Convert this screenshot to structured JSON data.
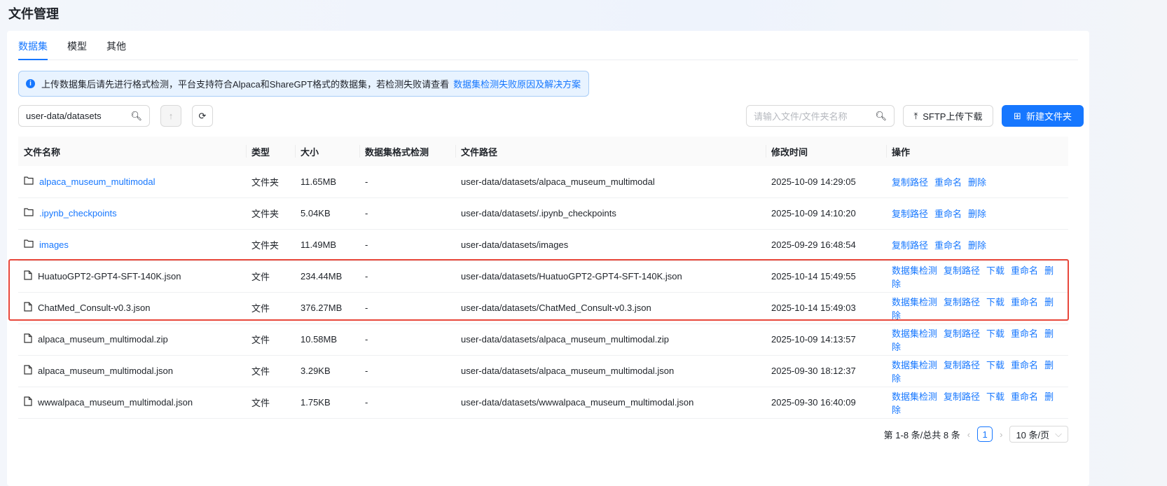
{
  "title": "文件管理",
  "tabs": [
    {
      "label": "数据集",
      "active": true
    },
    {
      "label": "模型"
    },
    {
      "label": "其他"
    }
  ],
  "notice": {
    "text": "上传数据集后请先进行格式检测，平台支持符合Alpaca和ShareGPT格式的数据集，若检测失败请查看",
    "link": "数据集检测失败原因及解决方案"
  },
  "path_input": {
    "value": "user-data/datasets"
  },
  "search": {
    "placeholder": "请输入文件/文件夹名称"
  },
  "buttons": {
    "sftp": "SFTP上传下载",
    "new_folder": "新建文件夹"
  },
  "columns": [
    "文件名称",
    "类型",
    "大小",
    "数据集格式检测",
    "文件路径",
    "修改时间",
    "操作"
  ],
  "rows": [
    {
      "name": "alpaca_museum_multimodal",
      "type": "文件夹",
      "size": "11.65MB",
      "check": "-",
      "path": "user-data/datasets/alpaca_museum_multimodal",
      "time": "2025-10-09 14:29:05",
      "folder": true,
      "ops": [
        "复制路径",
        "重命名",
        "删除"
      ]
    },
    {
      "name": ".ipynb_checkpoints",
      "type": "文件夹",
      "size": "5.04KB",
      "check": "-",
      "path": "user-data/datasets/.ipynb_checkpoints",
      "time": "2025-10-09 14:10:20",
      "folder": true,
      "ops": [
        "复制路径",
        "重命名",
        "删除"
      ]
    },
    {
      "name": "images",
      "type": "文件夹",
      "size": "11.49MB",
      "check": "-",
      "path": "user-data/datasets/images",
      "time": "2025-09-29 16:48:54",
      "folder": true,
      "ops": [
        "复制路径",
        "重命名",
        "删除"
      ]
    },
    {
      "name": "HuatuoGPT2-GPT4-SFT-140K.json",
      "type": "文件",
      "size": "234.44MB",
      "check": "-",
      "path": "user-data/datasets/HuatuoGPT2-GPT4-SFT-140K.json",
      "time": "2025-10-14 15:49:55",
      "ops": [
        "数据集检测",
        "复制路径",
        "下载",
        "重命名",
        "删除"
      ]
    },
    {
      "name": "ChatMed_Consult-v0.3.json",
      "type": "文件",
      "size": "376.27MB",
      "check": "-",
      "path": "user-data/datasets/ChatMed_Consult-v0.3.json",
      "time": "2025-10-14 15:49:03",
      "ops": [
        "数据集检测",
        "复制路径",
        "下载",
        "重命名",
        "删除"
      ]
    },
    {
      "name": "alpaca_museum_multimodal.zip",
      "type": "文件",
      "size": "10.58MB",
      "check": "-",
      "path": "user-data/datasets/alpaca_museum_multimodal.zip",
      "time": "2025-10-09 14:13:57",
      "ops": [
        "数据集检测",
        "复制路径",
        "下载",
        "重命名",
        "删除"
      ]
    },
    {
      "name": "alpaca_museum_multimodal.json",
      "type": "文件",
      "size": "3.29KB",
      "check": "-",
      "path": "user-data/datasets/alpaca_museum_multimodal.json",
      "time": "2025-09-30 18:12:37",
      "ops": [
        "数据集检测",
        "复制路径",
        "下载",
        "重命名",
        "删除"
      ]
    },
    {
      "name": "wwwalpaca_museum_multimodal.json",
      "type": "文件",
      "size": "1.75KB",
      "check": "-",
      "path": "user-data/datasets/wwwalpaca_museum_multimodal.json",
      "time": "2025-09-30 16:40:09",
      "ops": [
        "数据集检测",
        "复制路径",
        "下载",
        "重命名",
        "删除"
      ]
    }
  ],
  "pagination": {
    "summary": "第 1-8 条/总共 8 条",
    "current": "1",
    "page_size": "10 条/页"
  },
  "colors": {
    "accent": "#1677ff",
    "highlight": "#e8473b"
  }
}
